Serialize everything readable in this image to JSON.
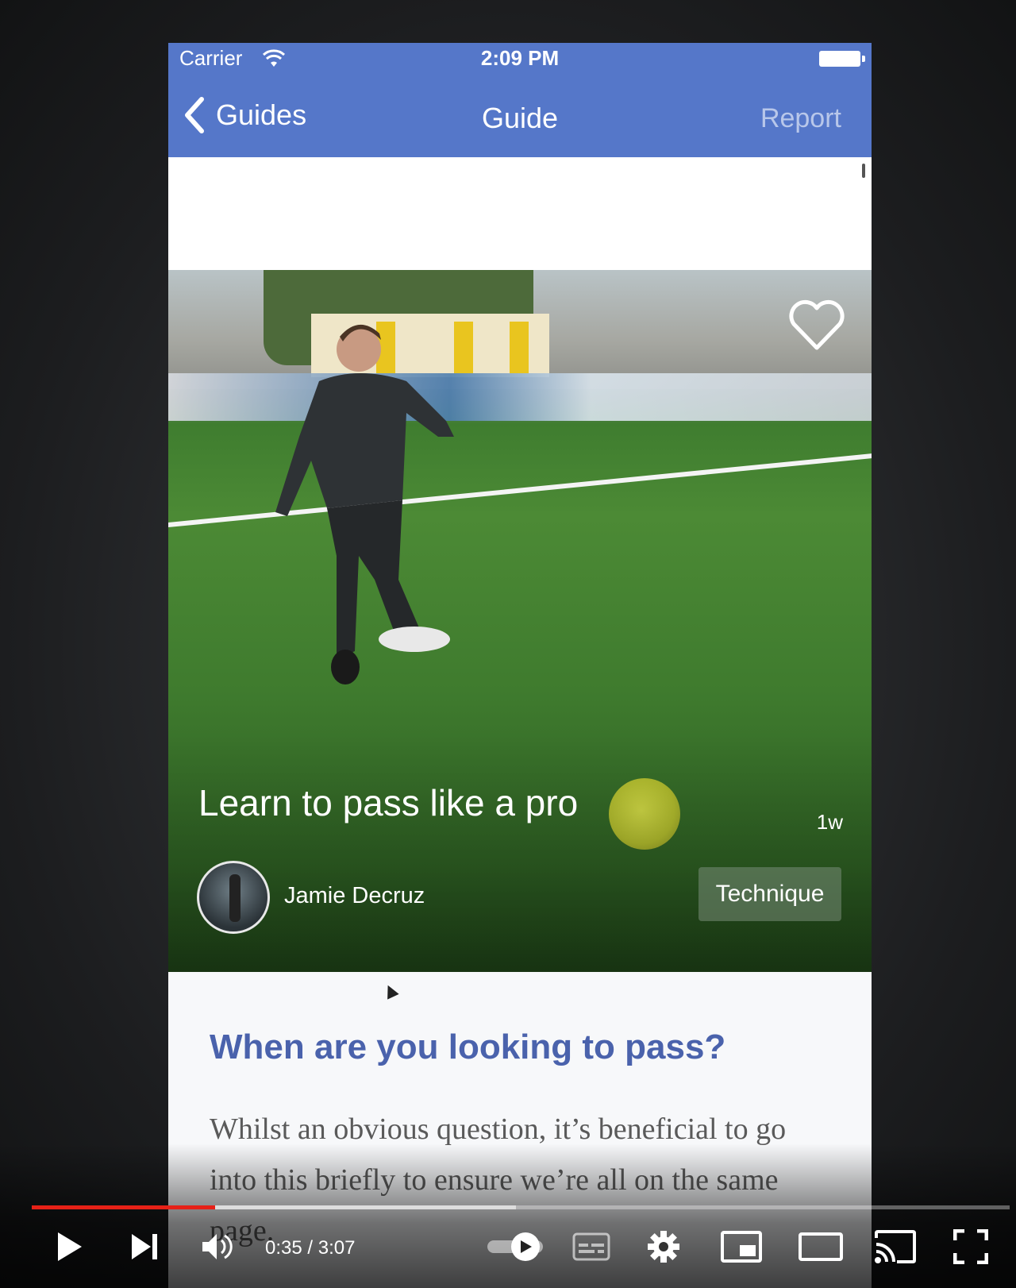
{
  "status_bar": {
    "carrier": "Carrier",
    "time": "2:09 PM"
  },
  "nav": {
    "back_label": "Guides",
    "title": "Guide",
    "action_label": "Report"
  },
  "hero": {
    "title": "Learn to pass like a pro",
    "age": "1w",
    "author": "Jamie Decruz",
    "tag": "Technique"
  },
  "article": {
    "heading": "When are you looking to pass?",
    "body": "Whilst an obvious question, it’s beneficial to go into this briefly to ensure we’re all on the same page."
  },
  "player": {
    "current_time": "0:35",
    "separator": " / ",
    "duration": "3:07",
    "played_fraction": 0.1875,
    "buffered_fraction": 0.495
  },
  "colors": {
    "nav_bg": "#5577c9",
    "heading": "#4a62ac",
    "progress": "#e62117"
  },
  "icons": [
    "chevron-left-icon",
    "wifi-icon",
    "battery-icon",
    "heart-icon",
    "play-icon",
    "next-icon",
    "volume-icon",
    "subtitles-icon",
    "settings-icon",
    "miniplayer-icon",
    "theater-icon",
    "cast-icon",
    "fullscreen-icon"
  ]
}
